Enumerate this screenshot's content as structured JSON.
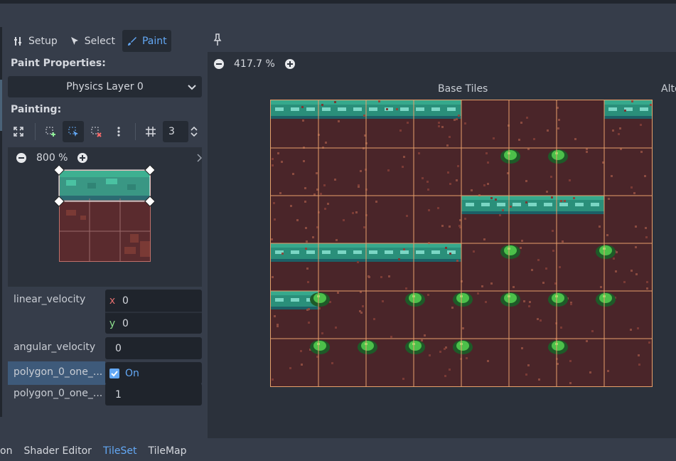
{
  "toolbar": {
    "tabs": [
      {
        "label": "Setup",
        "icon": "setup-icon"
      },
      {
        "label": "Select",
        "icon": "select-cursor-icon"
      },
      {
        "label": "Paint",
        "icon": "paint-brush-icon",
        "active": true
      }
    ]
  },
  "paint_properties": {
    "heading": "Paint Properties:",
    "layer_select": "Physics Layer 0"
  },
  "painting": {
    "heading": "Painting:",
    "snap_value": "3"
  },
  "polygon_editor": {
    "zoom": "800 %"
  },
  "properties": {
    "linear_velocity": {
      "label": "linear_velocity",
      "x_axis": "x",
      "x": "0",
      "y_axis": "y",
      "y": "0"
    },
    "angular_velocity": {
      "label": "angular_velocity",
      "value": "0"
    },
    "one_way": {
      "label": "polygon_0_one_...",
      "value": "On",
      "checked": true
    },
    "one_way_margin": {
      "label": "polygon_0_one_...",
      "value": "1"
    }
  },
  "atlas": {
    "zoom": "417.7 %",
    "title": "Base Tiles",
    "title_alt": "Alte"
  },
  "bottom_tabs": [
    {
      "label": "on"
    },
    {
      "label": "Shader Editor"
    },
    {
      "label": "TileSet",
      "active": true
    },
    {
      "label": "TileMap"
    }
  ],
  "colors": {
    "accent": "#63a8f5",
    "panel": "#2b313b",
    "dirt": "#4a2529",
    "grass": "#2a8f7a",
    "grid_line": "#e8a06a"
  }
}
